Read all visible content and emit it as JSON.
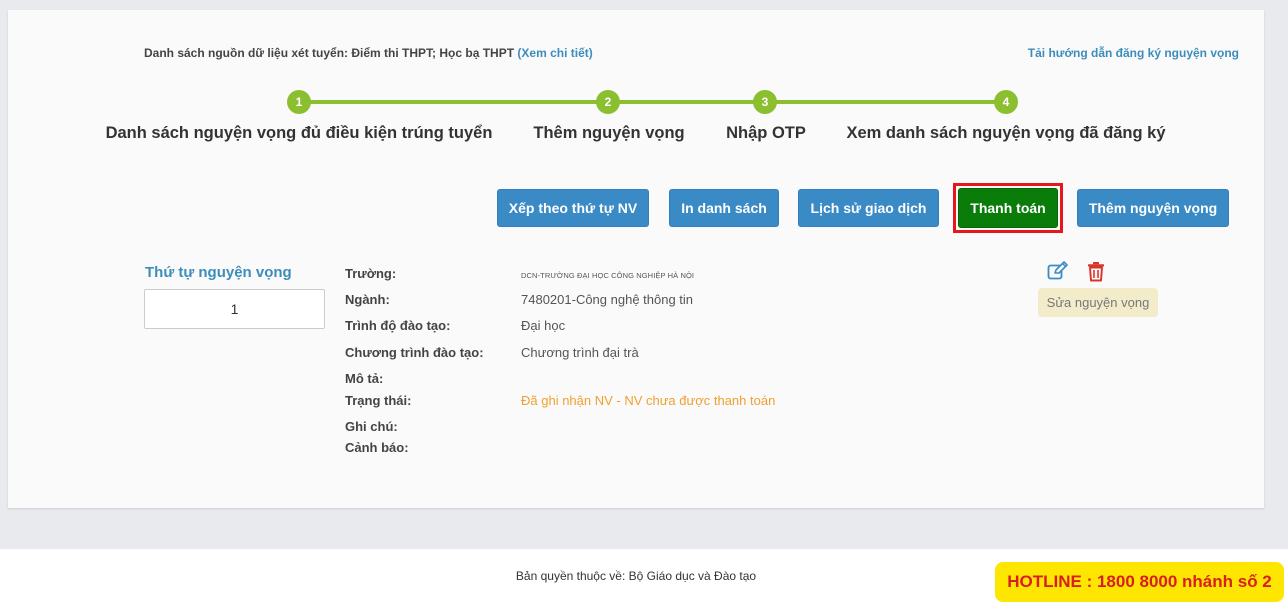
{
  "header": {
    "sources_label": "Danh sách nguồn dữ liệu xét tuyển: Điểm thi THPT; Học bạ THPT",
    "sources_link": "(Xem chi tiết)",
    "guide_link": "Tải hướng dẫn đăng ký nguyện vọng"
  },
  "steps": [
    {
      "number": "1",
      "label": "Danh sách nguyện vọng đủ điều kiện trúng tuyển"
    },
    {
      "number": "2",
      "label": "Thêm nguyện vọng"
    },
    {
      "number": "3",
      "label": "Nhập OTP"
    },
    {
      "number": "4",
      "label": "Xem danh sách nguyện vọng đã đăng ký"
    }
  ],
  "toolbar": {
    "sort_label": "Xếp theo thứ tự NV",
    "print_label": "In danh sách",
    "history_label": "Lịch sử giao dịch",
    "pay_label": "Thanh toán",
    "add_label": "Thêm nguyện vọng"
  },
  "wish": {
    "order_title": "Thứ tự nguyện vọng",
    "order_value": "1",
    "labels": {
      "school": "Trường:",
      "major": "Ngành:",
      "level": "Trình độ đào tạo:",
      "program": "Chương trình đào tạo:",
      "description": "Mô tả:",
      "status": "Trạng thái:",
      "note": "Ghi chú:",
      "warning": "Cảnh báo:"
    },
    "values": {
      "school": "DCN-TRƯỜNG ĐẠI HỌC CÔNG NGHIỆP HÀ NỘI",
      "major": "7480201-Công nghệ thông tin",
      "level": "Đại học",
      "program": "Chương trình đại trà",
      "status": "Đã ghi nhận NV - NV chưa được thanh toán"
    },
    "edit_tooltip": "Sửa nguyện vọng"
  },
  "footer": {
    "copyright": "Bản quyền thuộc về: Bộ Giáo dục và Đào tạo",
    "hotline": "HOTLINE : 1800 8000 nhánh số 2"
  },
  "colors": {
    "primary": "#3a8ac6",
    "pay": "#0a7c0a",
    "highlight": "#e8151d",
    "stepper": "#8bbf2f",
    "status": "#f0a030",
    "hotline_bg": "#ffe600",
    "hotline_text": "#d81e1e"
  },
  "icons": {
    "edit": "edit-icon",
    "delete": "trash-icon"
  }
}
